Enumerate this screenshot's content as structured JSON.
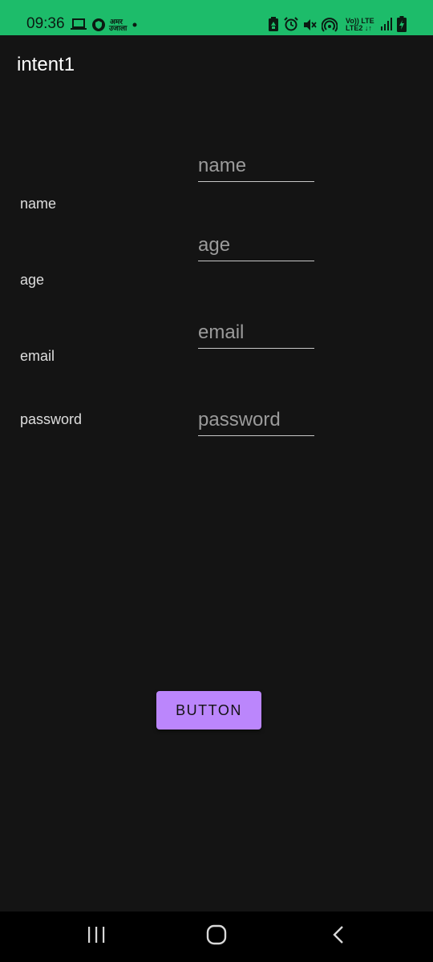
{
  "status_bar": {
    "time": "09:36",
    "network_label_top": "Vo)) LTE",
    "network_label_bottom": "LTE2 ↓↑",
    "news_icon_text_top": "अमर",
    "news_icon_text_bottom": "उजाला",
    "bg_color": "#1dbc6a",
    "icons": [
      "laptop-icon",
      "vpn-shield-icon",
      "news-app-icon",
      "dot-icon",
      "battery-saver-icon",
      "alarm-icon",
      "mute-icon",
      "hotspot-icon",
      "signal-icon",
      "battery-charging-icon"
    ]
  },
  "app_bar": {
    "title": "intent1"
  },
  "form": {
    "labels": {
      "name": "name",
      "age": "age",
      "email": "email",
      "password": "password"
    },
    "fields": {
      "name": {
        "placeholder": "name",
        "value": ""
      },
      "age": {
        "placeholder": "age",
        "value": ""
      },
      "email": {
        "placeholder": "email",
        "value": ""
      },
      "password": {
        "placeholder": "password",
        "value": ""
      }
    }
  },
  "button": {
    "label": "BUTTON",
    "color": "#bb86fc"
  },
  "nav_bar": {
    "icons": [
      "recents-icon",
      "home-icon",
      "back-icon"
    ]
  }
}
